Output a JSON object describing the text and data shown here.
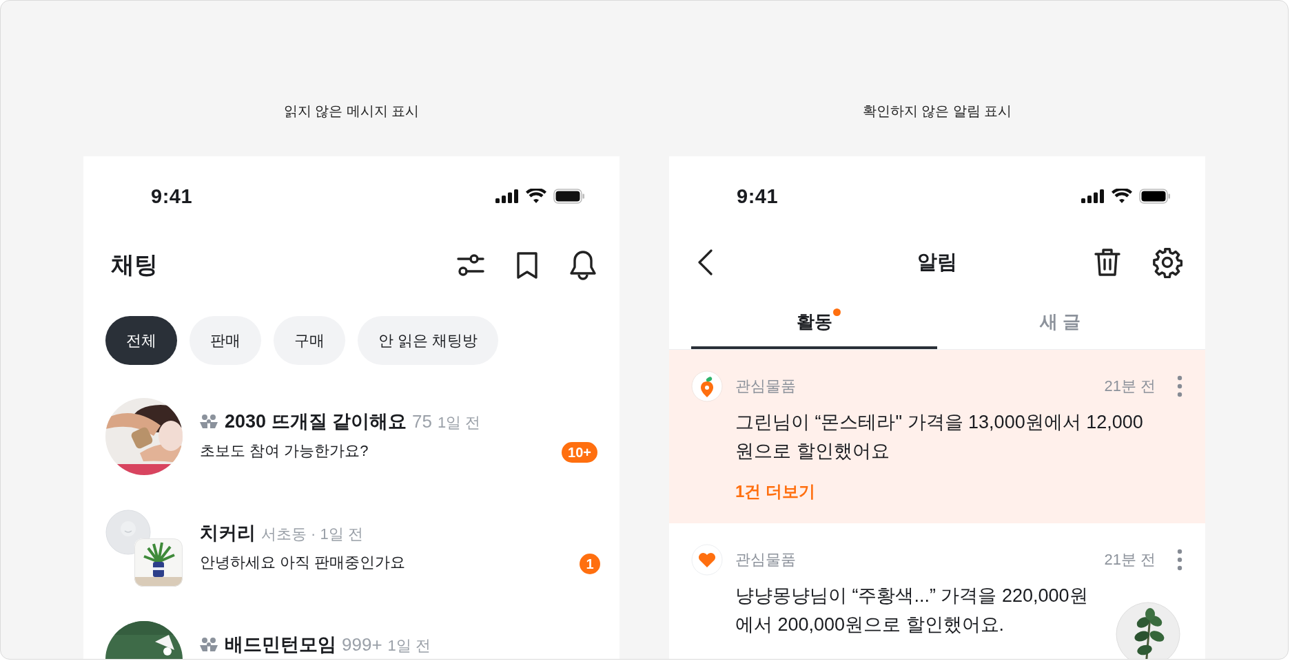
{
  "chat_panel": {
    "caption": "읽지 않은 메시지 표시",
    "status_time": "9:41",
    "title": "채팅",
    "filters": [
      {
        "label": "전체",
        "selected": true
      },
      {
        "label": "판매",
        "selected": false
      },
      {
        "label": "구매",
        "selected": false
      },
      {
        "label": "안 읽은 채팅방",
        "selected": false
      }
    ],
    "chats": [
      {
        "kind": "group",
        "name": "2030 뜨개질 같이해요",
        "count": "75",
        "time": "1일 전",
        "message": "초보도 참여 가능한가요?",
        "unread": "10+"
      },
      {
        "kind": "direct",
        "name": "치커리",
        "meta": "서초동 · 1일 전",
        "message": "안녕하세요 아직 판매중인가요",
        "unread": "1"
      },
      {
        "kind": "group",
        "name": "배드민턴모임",
        "count": "999+",
        "time": "1일 전"
      }
    ]
  },
  "notice_panel": {
    "caption": "확인하지 않은 알림 표시",
    "status_time": "9:41",
    "title": "알림",
    "tabs": [
      {
        "label": "활동",
        "selected": true,
        "dot": true
      },
      {
        "label": "새 글",
        "selected": false,
        "dot": false
      }
    ],
    "notifications": [
      {
        "kind": "carrot",
        "highlighted": true,
        "category": "관심물품",
        "time": "21분 전",
        "message": "그린님이 “몬스테라\" 가격을 13,000원에서 12,000원으로 할인했어요",
        "more": "1건 더보기"
      },
      {
        "kind": "heart",
        "highlighted": false,
        "category": "관심물품",
        "time": "21분 전",
        "message": "냥냥몽냥님이 “주황색...” 가격을 220,000원에서 200,000원으로 할인했어요."
      }
    ]
  }
}
